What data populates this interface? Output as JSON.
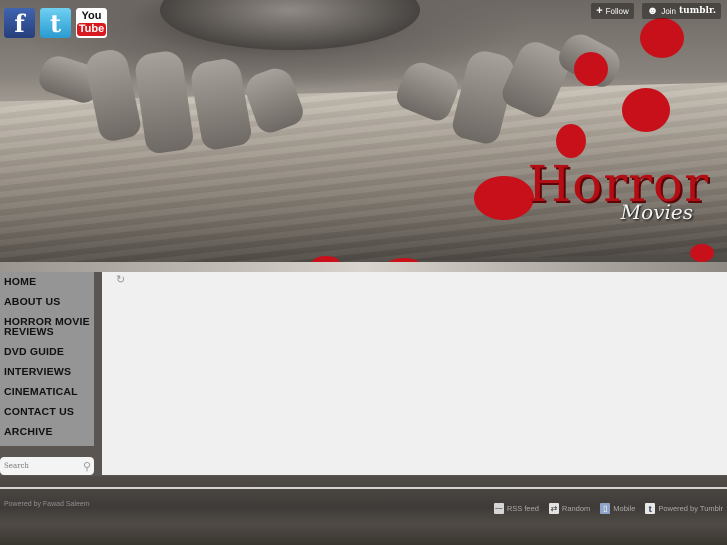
{
  "header": {
    "logo_title": "Horror",
    "logo_subtitle": "Movies",
    "social": [
      {
        "name": "facebook",
        "glyph": "f"
      },
      {
        "name": "twitter",
        "glyph": "t"
      },
      {
        "name": "youtube",
        "glyph_top": "You",
        "glyph_bottom": "Tube"
      }
    ],
    "tumblr_controls": {
      "follow_label": "Follow",
      "join_label": "Join",
      "join_brand": "tumblr."
    }
  },
  "nav": {
    "items": [
      {
        "label": "HOME"
      },
      {
        "label": "ABOUT US"
      },
      {
        "label": "HORROR MOVIE REVIEWS"
      },
      {
        "label": "DVD GUIDE"
      },
      {
        "label": "INTERVIEWS"
      },
      {
        "label": "CINEMATICAL"
      },
      {
        "label": "CONTACT US"
      },
      {
        "label": "ARCHIVE"
      }
    ]
  },
  "search": {
    "placeholder": "Search"
  },
  "footer": {
    "credit": "Powered by Fawad Saleem",
    "links": [
      {
        "label": "RSS feed",
        "icon": "rss-icon"
      },
      {
        "label": "Random",
        "icon": "shuffle-icon"
      },
      {
        "label": "Mobile",
        "icon": "mobile-icon"
      },
      {
        "label": "Powered by Tumblr",
        "icon": "tumblr-icon"
      }
    ]
  },
  "colors": {
    "blood_red": "#c8101a",
    "nav_bg": "#959595",
    "content_bg": "#f0f0f0"
  }
}
